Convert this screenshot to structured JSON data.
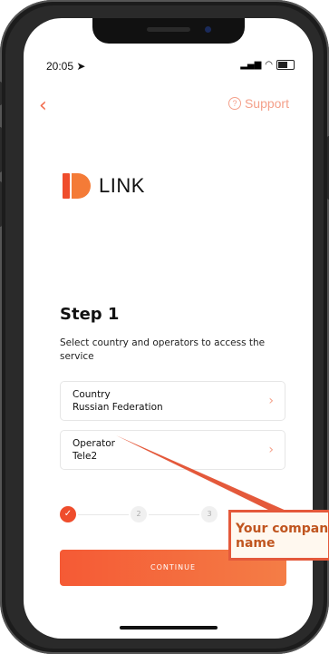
{
  "status_bar": {
    "time": "20:05"
  },
  "nav": {
    "back_icon": "chevron-left-icon",
    "support_label": "Support"
  },
  "logo": {
    "text": "LINK"
  },
  "step": {
    "title": "Step 1",
    "description": "Select country and operators to access the service"
  },
  "fields": {
    "country": {
      "label": "Country",
      "value": "Russian Federation"
    },
    "operator": {
      "label": "Operator",
      "value": "Tele2"
    }
  },
  "stepper": {
    "steps": [
      "2",
      "3"
    ]
  },
  "continue_label": "CONTINUE",
  "annotation": {
    "text": "Your company name"
  },
  "colors": {
    "accent": "#ef4d2c",
    "accent_light": "#f4a08a",
    "callout_border": "#e4593b"
  }
}
